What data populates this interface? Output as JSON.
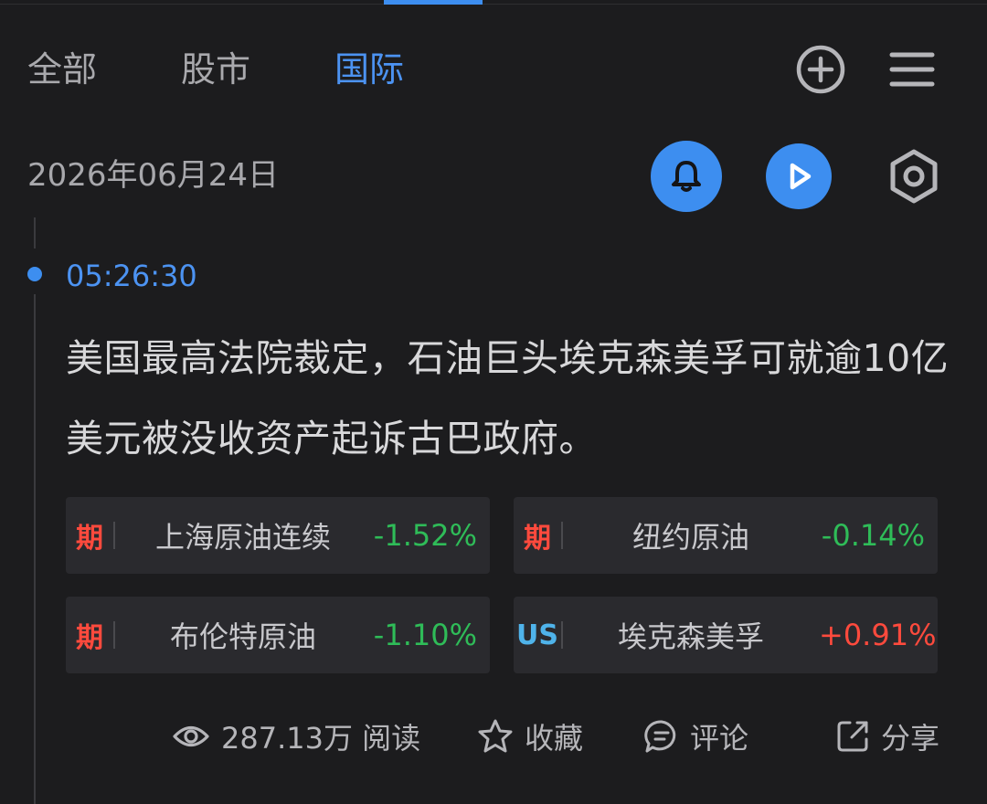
{
  "tabs": [
    {
      "label": "全部",
      "active": false
    },
    {
      "label": "股市",
      "active": false
    },
    {
      "label": "国际",
      "active": true
    }
  ],
  "top_icons": [
    "add-circle-icon",
    "menu-icon"
  ],
  "date": "2026年06月24日",
  "action_icons": [
    "bell-icon",
    "play-icon",
    "hexagon-settings-icon"
  ],
  "news": {
    "time": "05:26:30",
    "headline": "美国最高法院裁定，石油巨头埃克森美孚可就逾10亿美元被没收资产起诉古巴政府。"
  },
  "quotes": [
    {
      "badge": "期",
      "name": "上海原油连续",
      "change": "-1.52%",
      "direction": "down"
    },
    {
      "badge": "期",
      "name": "纽约原油",
      "change": "-0.14%",
      "direction": "down"
    },
    {
      "badge": "期",
      "name": "布伦特原油",
      "change": "-1.10%",
      "direction": "down"
    },
    {
      "badge": "US",
      "name": "埃克森美孚",
      "change": "+0.91%",
      "direction": "up"
    }
  ],
  "footer": {
    "views": "287.13万 阅读",
    "favorite": "收藏",
    "comment": "评论",
    "share": "分享"
  },
  "colors": {
    "accent": "#3d8ef0",
    "down": "#2fbc58",
    "up": "#ff4a3d",
    "background": "#1c1c1e",
    "card": "#2a2a2e"
  }
}
